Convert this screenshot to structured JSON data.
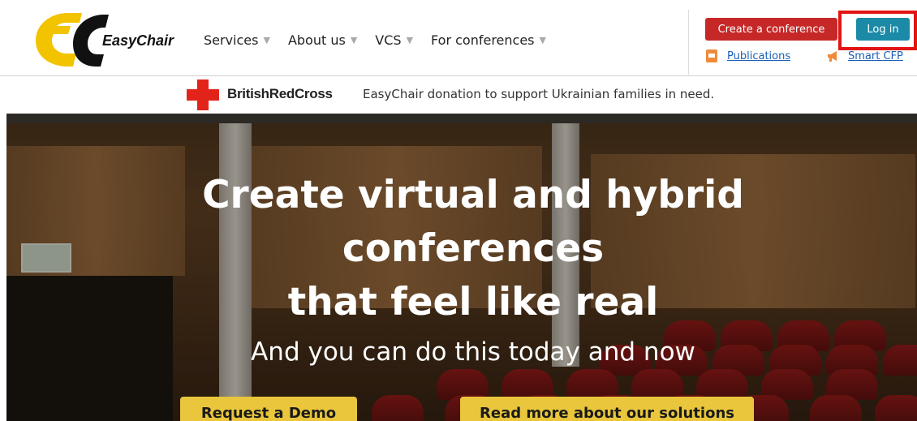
{
  "brand": {
    "name": "EasyChair"
  },
  "nav": [
    {
      "label": "Services",
      "caret": "▼"
    },
    {
      "label": "About us",
      "caret": "▼"
    },
    {
      "label": "VCS",
      "caret": "▼"
    },
    {
      "label": "For conferences",
      "caret": "▼"
    }
  ],
  "header_actions": {
    "create_conference": "Create a conference",
    "login": "Log in",
    "publications": "Publications",
    "smart_cfp": "Smart CFP"
  },
  "donation": {
    "partner": "BritishRedCross",
    "text": "EasyChair donation to support Ukrainian families in need."
  },
  "hero": {
    "title_line1": "Create virtual and hybrid",
    "title_line2": "conferences",
    "title_line3": "that feel like real",
    "subtitle": "And you can do this today and now",
    "cta_demo": "Request a Demo",
    "cta_read": "Read more about our solutions"
  },
  "colors": {
    "create_button": "#c62828",
    "login_button": "#1a8aa6",
    "highlight_box": "#e31414",
    "cta": "#e9c63b",
    "link": "#1a5fb4",
    "red_cross": "#e2231a"
  },
  "icons": {
    "publications": "publications-icon",
    "smart_cfp": "megaphone-icon",
    "red_cross": "red-cross-icon"
  }
}
